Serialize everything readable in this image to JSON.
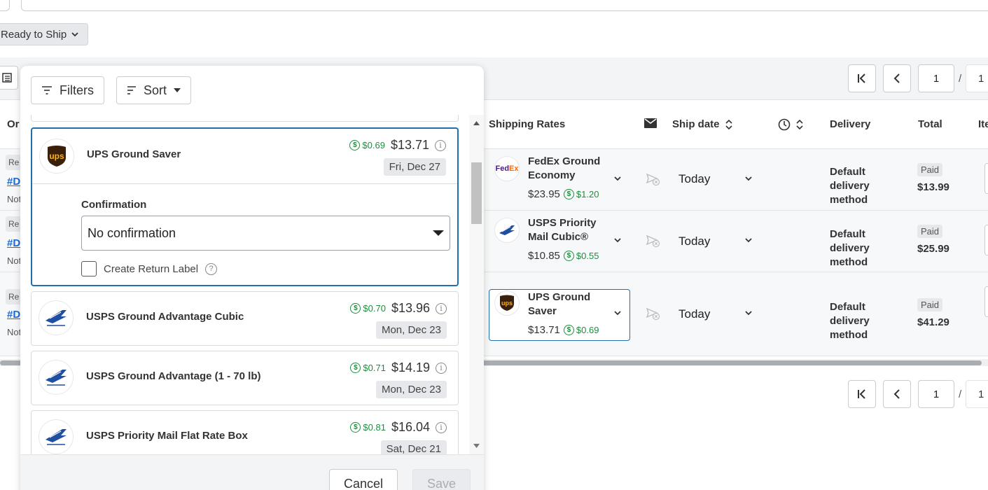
{
  "toolbar": {
    "status_filter": "Ready to Ship"
  },
  "pagination_top": {
    "page": "1",
    "separator": "/",
    "total": "1"
  },
  "pagination_bottom": {
    "page": "1",
    "separator": "/",
    "total": "1"
  },
  "table": {
    "left_col_header": "Or",
    "columns": {
      "shipping_rates": "Shipping Rates",
      "ship_date": "Ship date",
      "delivery": "Delivery",
      "total": "Total",
      "items": "Ite"
    },
    "rows": [
      {
        "left_badge": "Re",
        "left_link": "#D",
        "left_note": "Not",
        "carrier_name": "FedEx Ground Economy",
        "carrier_logo": "FedEx",
        "rate_price": "$23.95",
        "rate_rebate": "$1.20",
        "ship_date": "Today",
        "delivery": "Default delivery method",
        "paid": "Paid",
        "total": "$13.99"
      },
      {
        "left_badge": "Re",
        "left_link": "#D",
        "left_note": "Not",
        "carrier_name": "USPS Priority Mail Cubic®",
        "carrier_logo": "usps-eagle-icon",
        "rate_price": "$10.85",
        "rate_rebate": "$0.55",
        "ship_date": "Today",
        "delivery": "Default delivery method",
        "paid": "Paid",
        "total": "$25.99"
      },
      {
        "left_badge": "Re",
        "left_link": "#D",
        "left_note": "Not",
        "carrier_name": "UPS Ground Saver",
        "carrier_logo": "ups",
        "rate_price": "$13.71",
        "rate_rebate": "$0.69",
        "ship_date": "Today",
        "delivery": "Default delivery method",
        "paid": "Paid",
        "total": "$41.29"
      }
    ]
  },
  "modal": {
    "filters_label": "Filters",
    "sort_label": "Sort",
    "selected_rate": {
      "name": "UPS Ground Saver",
      "rebate": "$0.69",
      "price": "$13.71",
      "date": "Fri, Dec 27",
      "confirmation_label": "Confirmation",
      "confirmation_value": "No confirmation",
      "return_label": "Create Return Label",
      "logo_text": "ups"
    },
    "rates": [
      {
        "name": "USPS Ground Advantage Cubic",
        "rebate": "$0.70",
        "price": "$13.96",
        "date": "Mon, Dec 23"
      },
      {
        "name": "USPS Ground Advantage (1 - 70 lb)",
        "rebate": "$0.71",
        "price": "$14.19",
        "date": "Mon, Dec 23"
      },
      {
        "name": "USPS Priority Mail Flat Rate Box",
        "rebate": "$0.81",
        "price": "$16.04",
        "date": "Sat, Dec 21"
      }
    ],
    "cancel_label": "Cancel",
    "save_label": "Save"
  },
  "colors": {
    "accent_blue": "#1f6fae",
    "rebate_green": "#1a8f3c",
    "link_blue": "#1d6bd6"
  }
}
